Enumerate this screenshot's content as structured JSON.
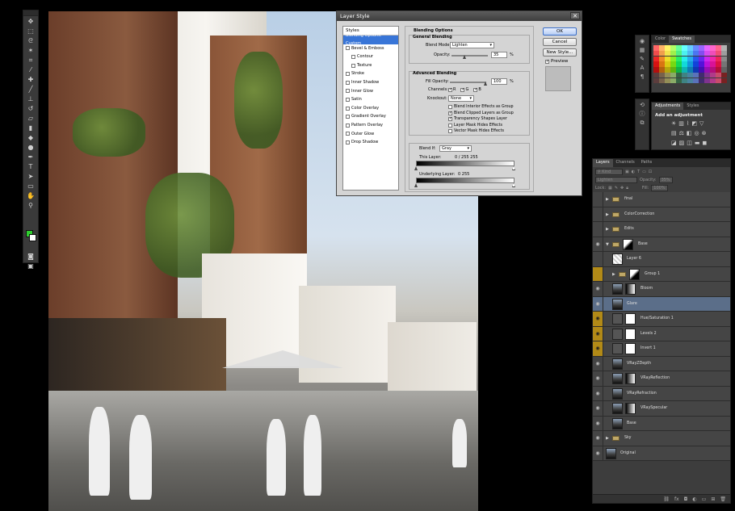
{
  "dialog": {
    "title": "Layer Style",
    "styles_header": "Styles",
    "styles": [
      {
        "label": "Blending Options: Custom",
        "checkbox": false,
        "selected": true,
        "indent": false
      },
      {
        "label": "Bevel & Emboss",
        "checkbox": true,
        "checked": false,
        "indent": false
      },
      {
        "label": "Contour",
        "checkbox": true,
        "checked": false,
        "indent": true
      },
      {
        "label": "Texture",
        "checkbox": true,
        "checked": false,
        "indent": true
      },
      {
        "label": "Stroke",
        "checkbox": true,
        "checked": false,
        "indent": false
      },
      {
        "label": "Inner Shadow",
        "checkbox": true,
        "checked": false,
        "indent": false
      },
      {
        "label": "Inner Glow",
        "checkbox": true,
        "checked": false,
        "indent": false
      },
      {
        "label": "Satin",
        "checkbox": true,
        "checked": false,
        "indent": false
      },
      {
        "label": "Color Overlay",
        "checkbox": true,
        "checked": false,
        "indent": false
      },
      {
        "label": "Gradient Overlay",
        "checkbox": true,
        "checked": false,
        "indent": false
      },
      {
        "label": "Pattern Overlay",
        "checkbox": true,
        "checked": false,
        "indent": false
      },
      {
        "label": "Outer Glow",
        "checkbox": true,
        "checked": false,
        "indent": false
      },
      {
        "label": "Drop Shadow",
        "checkbox": true,
        "checked": false,
        "indent": false
      }
    ],
    "blending_options": "Blending Options",
    "general_blending": "General Blending",
    "blend_mode_label": "Blend Mode:",
    "blend_mode_value": "Lighten",
    "opacity_label": "Opacity:",
    "opacity_value": "35",
    "percent": "%",
    "advanced_blending": "Advanced Blending",
    "fill_opacity_label": "Fill Opacity:",
    "fill_opacity_value": "100",
    "channels_label": "Channels:",
    "channels": [
      {
        "label": "R",
        "checked": true
      },
      {
        "label": "G",
        "checked": true
      },
      {
        "label": "B",
        "checked": true
      }
    ],
    "knockout_label": "Knockout:",
    "knockout_value": "None",
    "advanced_checks": [
      {
        "label": "Blend Interior Effects as Group",
        "checked": false
      },
      {
        "label": "Blend Clipped Layers as Group",
        "checked": true
      },
      {
        "label": "Transparency Shapes Layer",
        "checked": true
      },
      {
        "label": "Layer Mask Hides Effects",
        "checked": false
      },
      {
        "label": "Vector Mask Hides Effects",
        "checked": false
      }
    ],
    "blend_if_label": "Blend If:",
    "blend_if_value": "Gray",
    "this_layer_label": "This Layer:",
    "this_layer_values": "0   /   255      255",
    "underlying_label": "Underlying Layer:",
    "underlying_values": "0                  255",
    "ok": "OK",
    "cancel": "Cancel",
    "new_style": "New Style...",
    "preview_label": "Preview",
    "preview_checked": true
  },
  "swatches_panel": {
    "tabs": [
      "Color",
      "Swatches"
    ],
    "active_tab": "Swatches"
  },
  "adjustments_panel": {
    "tabs": [
      "Adjustments",
      "Styles"
    ],
    "active_tab": "Adjustments",
    "title": "Add an adjustment"
  },
  "layers_panel": {
    "tabs": [
      "Layers",
      "Channels",
      "Paths"
    ],
    "active_tab": "Layers",
    "kind_label": "Kind",
    "blend_mode": "Lighten",
    "opacity_label": "Opacity:",
    "opacity_value": "35%",
    "lock_label": "Lock:",
    "fill_label": "Fill:",
    "fill_value": "100%",
    "layers": [
      {
        "name": "final",
        "type": "group",
        "visible": false,
        "depth": 0
      },
      {
        "name": "ColorCorrection",
        "type": "group",
        "visible": false,
        "depth": 0
      },
      {
        "name": "Edits",
        "type": "group",
        "visible": false,
        "depth": 0
      },
      {
        "name": "Base",
        "type": "group-open",
        "visible": true,
        "depth": 0
      },
      {
        "name": "Layer 6",
        "type": "layer",
        "visible": false,
        "depth": 1
      },
      {
        "name": "Group 1",
        "type": "group",
        "visible": false,
        "depth": 1,
        "highlight": "gold"
      },
      {
        "name": "Bloom",
        "type": "layer",
        "visible": true,
        "depth": 1
      },
      {
        "name": "Glare",
        "type": "layer",
        "visible": true,
        "depth": 1,
        "selected": true
      },
      {
        "name": "Hue/Saturation 1",
        "type": "adjustment",
        "visible": true,
        "depth": 1,
        "highlight": "gold"
      },
      {
        "name": "Levels 2",
        "type": "adjustment",
        "visible": true,
        "depth": 1,
        "highlight": "gold"
      },
      {
        "name": "Invert 1",
        "type": "adjustment",
        "visible": true,
        "depth": 1,
        "highlight": "gold"
      },
      {
        "name": "VRayZDepth",
        "type": "layer",
        "visible": true,
        "depth": 1
      },
      {
        "name": "VRayReflection",
        "type": "layer",
        "visible": true,
        "depth": 1
      },
      {
        "name": "VRayRefraction",
        "type": "layer",
        "visible": true,
        "depth": 1
      },
      {
        "name": "VRaySpecular",
        "type": "layer",
        "visible": true,
        "depth": 1
      },
      {
        "name": "Base",
        "type": "layer",
        "visible": true,
        "depth": 1
      },
      {
        "name": "Sky",
        "type": "group",
        "visible": true,
        "depth": 0
      },
      {
        "name": "Original",
        "type": "layer",
        "visible": true,
        "depth": 0
      }
    ]
  }
}
